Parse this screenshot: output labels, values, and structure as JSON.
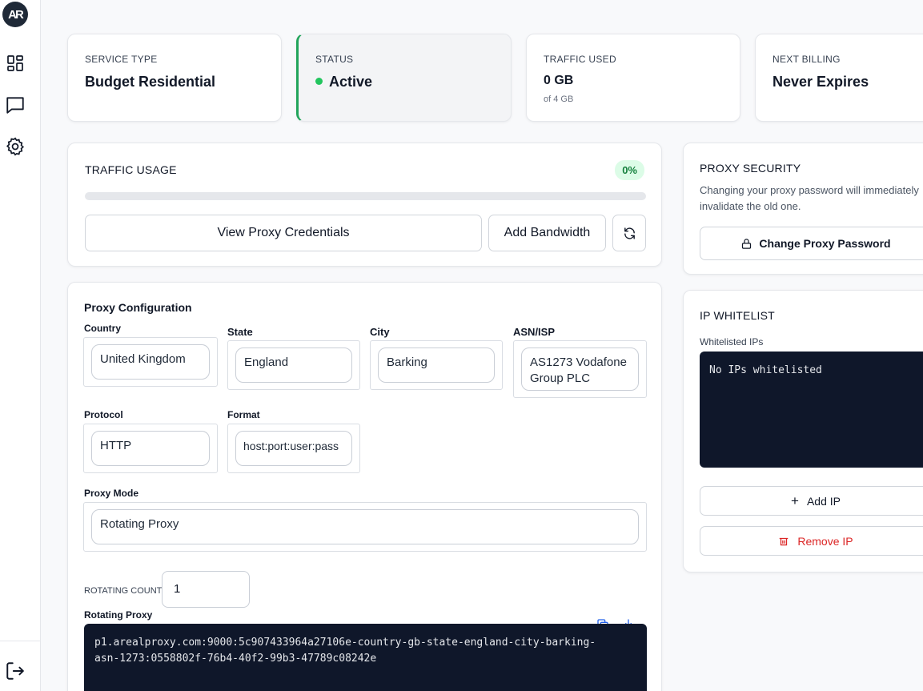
{
  "brand": {
    "logo_text": "AR"
  },
  "sidebar": {
    "icons": [
      "dashboard-icon",
      "chat-icon",
      "gear-icon"
    ],
    "bottom_icon": "logout-icon"
  },
  "stats": [
    {
      "label": "SERVICE TYPE",
      "value": "Budget Residential"
    },
    {
      "label": "STATUS",
      "value": "Active",
      "color": "#22c55e"
    },
    {
      "label": "TRAFFIC USED",
      "value": "0 GB",
      "sub": "of 4 GB"
    },
    {
      "label": "NEXT BILLING",
      "value": "Never Expires"
    }
  ],
  "traffic": {
    "title": "TRAFFIC USAGE",
    "percent_label": "0%",
    "percent": 0,
    "view_credentials": "View Proxy Credentials",
    "add_bandwidth": "Add Bandwidth",
    "refresh_icon": "refresh-icon"
  },
  "config": {
    "title": "Proxy Configuration",
    "country_label": "Country",
    "country_value": "United Kingdom",
    "state_label": "State",
    "state_value": "England",
    "city_label": "City",
    "city_value": "Barking",
    "asn_label": "ASN/ISP",
    "asn_value": "AS1273 Vodafone Group PLC",
    "protocol_label": "Protocol",
    "protocol_value": "HTTP",
    "format_label": "Format",
    "format_value": "host:port:user:pass",
    "mode_label": "Proxy Mode",
    "mode_value": "Rotating Proxy",
    "rotating_count_label": "ROTATING COUNT",
    "rotating_count_value": "1",
    "rotating_proxy_label": "Rotating Proxy",
    "proxy_string": "p1.arealproxy.com:9000:5c907433964a27106e-country-gb-state-england-city-barking-asn-1273:0558802f-76b4-40f2-99b3-47789c08242e"
  },
  "security": {
    "title": "PROXY SECURITY",
    "description": "Changing your proxy password will immediately invalidate the old one.",
    "change_password": "Change Proxy Password"
  },
  "whitelist": {
    "title": "IP WHITELIST",
    "list_label": "Whitelisted IPs",
    "empty_text": "No IPs whitelisted",
    "add_ip": "Add IP",
    "remove_ip": "Remove IP",
    "remove_color": "#dc2626"
  }
}
